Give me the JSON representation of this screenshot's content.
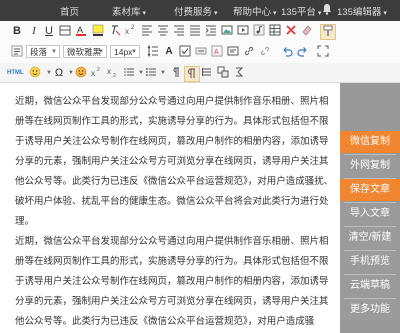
{
  "topnav": {
    "items": [
      "首页",
      "素材库",
      "付费服务",
      "帮助中心",
      "135平台",
      "135编辑器"
    ],
    "caret": "▾"
  },
  "toolbar": {
    "select_paragraph": "段落",
    "select_font": "微软雅黑",
    "select_size": "14px",
    "html_label": "HTML",
    "omega": "Ω"
  },
  "content": {
    "paragraphs": [
      "近期，微信公众平台发现部分公众号通过向用户提供制作音乐相册、照片相册等在线网页制作工具的形式，实施诱导分享的行为。具体形式包括但不限于诱导用户关注公众号制作在线网页，篡改用户制作的相册内容，添加诱导分享的元素，强制用户关注公众号方可浏览分享在线网页，诱导用户关注其他公众号等。此类行为已违反《微信公众平台运营规范》，对用户造成骚扰、破坏用户体验、扰乱平台的健康生态。微信公众平台将会对此类行为进行处理。",
      "近期，微信公众平台发现部分公众号通过向用户提供制作音乐相册、照片相册等在线网页制作工具的形式，实施诱导分享的行为。具体形式包括但不限于诱导用户关注公众号制作在线网页，篡改用户制作的相册内容，添加诱导分享的元素，强制用户关注公众号方可浏览分享在线网页，诱导用户关注其他公众号等。此类行为已违反《微信公众平台运营规范》，对用户造成骚"
    ]
  },
  "sidebar": {
    "buttons": [
      "微信复制",
      "外网复制",
      "保存文章",
      "导入文章",
      "清空/新建",
      "手机预览",
      "云端草稿",
      "更多功能"
    ]
  },
  "colors": {
    "accent": "#f08532",
    "topnav_bg": "#3c3c3c",
    "sidebar_bg": "#9b9b9b"
  }
}
